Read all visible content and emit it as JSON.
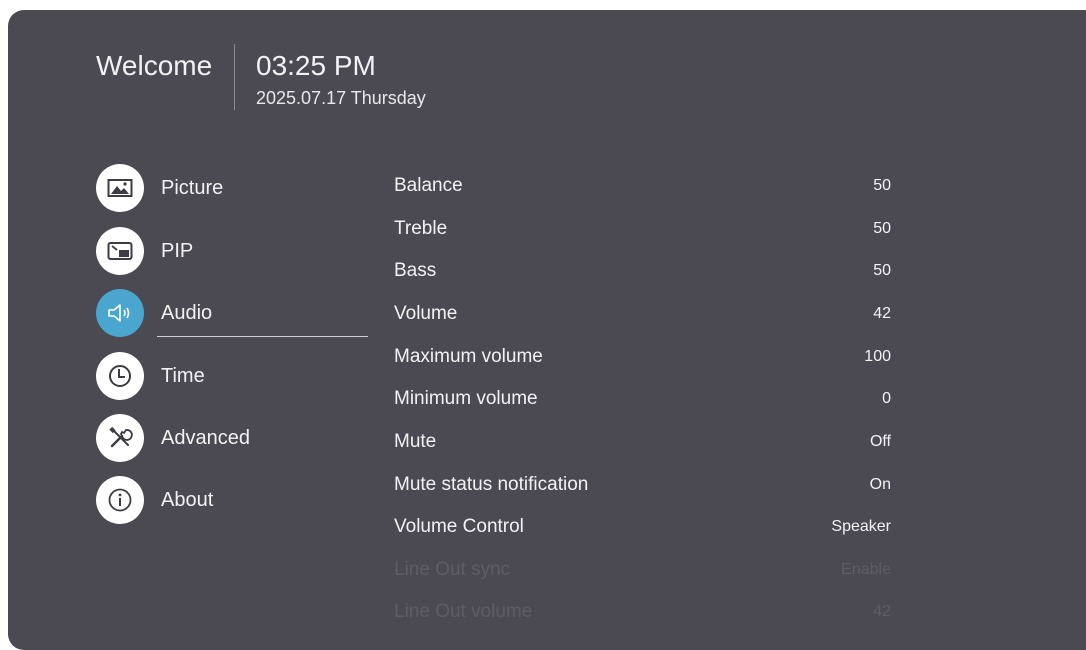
{
  "header": {
    "welcome": "Welcome",
    "time": "03:25 PM",
    "date": "2025.07.17 Thursday"
  },
  "menu": {
    "items": [
      {
        "label": "Picture",
        "icon": "picture-icon"
      },
      {
        "label": "PIP",
        "icon": "pip-icon"
      },
      {
        "label": "Audio",
        "icon": "speaker-icon",
        "active": true
      },
      {
        "label": "Time",
        "icon": "clock-icon"
      },
      {
        "label": "Advanced",
        "icon": "tools-icon"
      },
      {
        "label": "About",
        "icon": "info-icon"
      }
    ]
  },
  "settings": {
    "rows": [
      {
        "label": "Balance",
        "value": "50"
      },
      {
        "label": "Treble",
        "value": "50"
      },
      {
        "label": "Bass",
        "value": "50"
      },
      {
        "label": "Volume",
        "value": "42"
      },
      {
        "label": "Maximum volume",
        "value": "100"
      },
      {
        "label": "Minimum volume",
        "value": "0"
      },
      {
        "label": "Mute",
        "value": "Off"
      },
      {
        "label": "Mute status notification",
        "value": "On"
      },
      {
        "label": "Volume Control",
        "value": "Speaker"
      },
      {
        "label": "Line Out sync",
        "value": "Enable",
        "disabled": true
      },
      {
        "label": "Line Out volume",
        "value": "42",
        "disabled": true
      }
    ]
  },
  "colors": {
    "panel": "#4b4a52",
    "accent": "#4aa6cf",
    "text": "#f2f2f4",
    "disabled_text": "#5e5d66"
  }
}
